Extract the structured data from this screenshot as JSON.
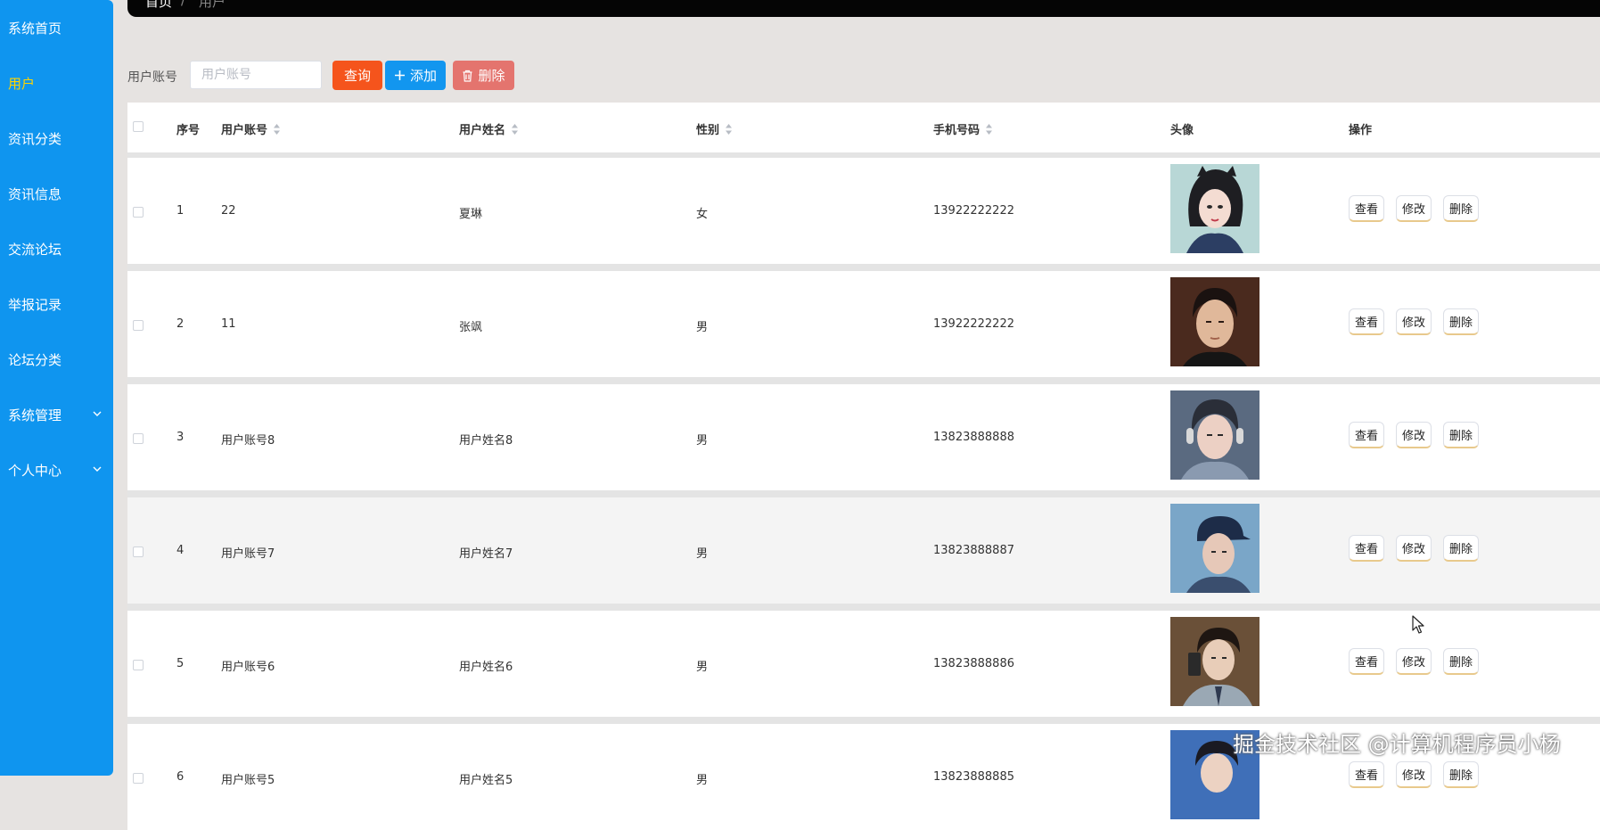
{
  "sidebar": {
    "items": [
      {
        "label": "系统首页"
      },
      {
        "label": "用户"
      },
      {
        "label": "资讯分类"
      },
      {
        "label": "资讯信息"
      },
      {
        "label": "交流论坛"
      },
      {
        "label": "举报记录"
      },
      {
        "label": "论坛分类"
      },
      {
        "label": "系统管理"
      },
      {
        "label": "个人中心"
      }
    ],
    "active_index": 1
  },
  "breadcrumb": {
    "home": "首页",
    "separator": "/",
    "current": "用户"
  },
  "search": {
    "label": "用户账号",
    "placeholder": "用户账号",
    "value": ""
  },
  "toolbar": {
    "query_label": "查询",
    "add_icon": "plus-icon",
    "add_label": "添加",
    "delete_icon": "trash-icon",
    "delete_label": "删除"
  },
  "table": {
    "headers": {
      "index": "序号",
      "account": "用户账号",
      "name": "用户姓名",
      "gender": "性别",
      "phone": "手机号码",
      "avatar": "头像",
      "actions": "操作"
    },
    "actions": {
      "view": "查看",
      "edit": "修改",
      "delete": "删除"
    },
    "rows": [
      {
        "index": "1",
        "account": "22",
        "name": "夏琳",
        "gender": "女",
        "phone": "13922222222"
      },
      {
        "index": "2",
        "account": "11",
        "name": "张飒",
        "gender": "男",
        "phone": "13922222222"
      },
      {
        "index": "3",
        "account": "用户账号8",
        "name": "用户姓名8",
        "gender": "男",
        "phone": "13823888888"
      },
      {
        "index": "4",
        "account": "用户账号7",
        "name": "用户姓名7",
        "gender": "男",
        "phone": "13823888887"
      },
      {
        "index": "5",
        "account": "用户账号6",
        "name": "用户姓名6",
        "gender": "男",
        "phone": "13823888886"
      },
      {
        "index": "6",
        "account": "用户账号5",
        "name": "用户姓名5",
        "gender": "男",
        "phone": "13823888885"
      }
    ]
  },
  "watermark": "掘金技术社区 @计算机程序员小杨",
  "colors": {
    "sidebar": "#0f95ef",
    "active_item": "#ffd400",
    "query_button": "#f5541c",
    "add_button": "#1296ef",
    "delete_button": "#e4746e"
  }
}
